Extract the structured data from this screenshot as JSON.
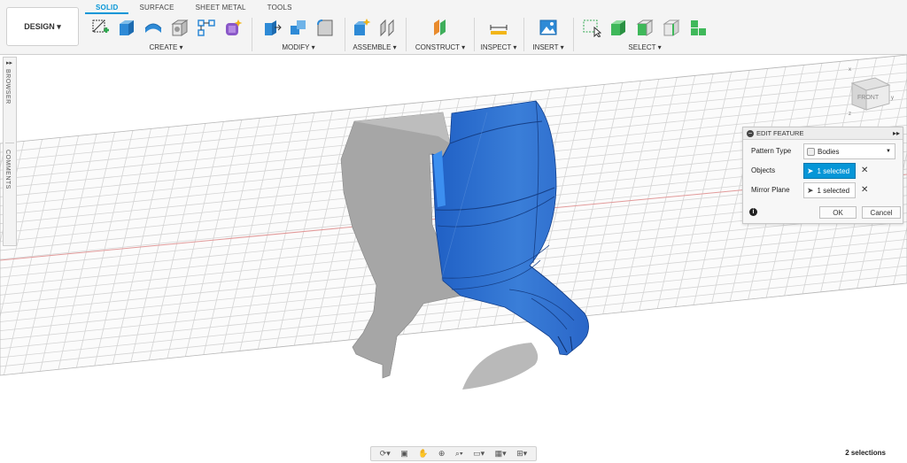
{
  "toolbar": {
    "design_label": "DESIGN ▾",
    "tabs": [
      "SOLID",
      "SURFACE",
      "SHEET METAL",
      "TOOLS"
    ],
    "groups": {
      "create": "CREATE ▾",
      "modify": "MODIFY ▾",
      "assemble": "ASSEMBLE ▾",
      "construct": "CONSTRUCT ▾",
      "inspect": "INSPECT ▾",
      "insert": "INSERT ▾",
      "select": "SELECT ▾"
    },
    "icons": {
      "create": [
        "sketch-icon",
        "extrude-icon",
        "revolve-icon",
        "shell-icon",
        "rectangular-pattern-icon",
        "form-icon"
      ],
      "modify": [
        "press-pull-icon",
        "combine-icon",
        "fillet-icon"
      ],
      "assemble": [
        "new-component-icon",
        "joint-icon"
      ],
      "construct": [
        "plane-icon"
      ],
      "inspect": [
        "measure-icon"
      ],
      "insert": [
        "insert-image-icon"
      ],
      "select": [
        "window-select-icon",
        "select-body-icon",
        "select-face-icon",
        "select-edge-icon",
        "select-component-icon"
      ]
    },
    "accent": "#0696d7"
  },
  "left_panel": {
    "browser": "BROWSER",
    "comments": "COMMENTS"
  },
  "viewcube": {
    "face_label": "FRONT"
  },
  "dialog": {
    "title": "EDIT FEATURE",
    "rows": [
      {
        "label": "Pattern Type",
        "value": "Bodies"
      },
      {
        "label": "Objects",
        "value": "1 selected"
      },
      {
        "label": "Mirror Plane",
        "value": "1 selected"
      }
    ],
    "ok": "OK",
    "cancel": "Cancel"
  },
  "status": {
    "selections": "2 selections"
  },
  "colors": {
    "selected_body": "#2f6fd0",
    "body_gray": "#a8a8a8",
    "grid": "#d0d0d0"
  }
}
